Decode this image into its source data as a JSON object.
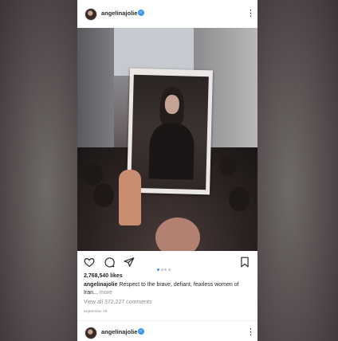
{
  "post": {
    "username": "angelinajolie",
    "more_icon": "⋮",
    "verified_icon": "✓",
    "likes": "2,768,540 likes",
    "caption_user": "angelinajolie",
    "caption_text": "Respect to the brave, defiant, fearless women of Iran...",
    "caption_more": "more",
    "comments": "View all 372,227 comments",
    "date": "September 29",
    "carousel": {
      "count": 4,
      "active": 1
    }
  },
  "next_post": {
    "username": "angelinajolie",
    "more_icon": "⋮",
    "verified_icon": "✓"
  },
  "icons": [
    "heart-icon",
    "comment-icon",
    "share-icon",
    "bookmark-icon",
    "verified-icon",
    "more-icon"
  ],
  "colors": {
    "accent": "#3897f0",
    "text": "#262626",
    "muted": "#8e8e8e"
  }
}
